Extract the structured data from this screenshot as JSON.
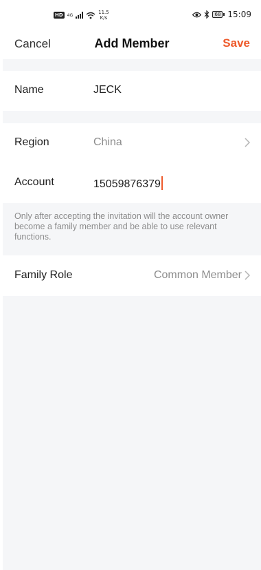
{
  "status_bar": {
    "hd": "HD",
    "network": "4G",
    "speed_value": "11.5",
    "speed_unit": "K/s",
    "battery": "68",
    "time": "15:09"
  },
  "nav": {
    "cancel": "Cancel",
    "title": "Add Member",
    "save": "Save",
    "accent_color": "#ee5a2b"
  },
  "form": {
    "name": {
      "label": "Name",
      "value": "JECK"
    },
    "region": {
      "label": "Region",
      "value": "China"
    },
    "account": {
      "label": "Account",
      "value": "15059876379"
    },
    "notice": "Only after accepting the invitation will the account owner become a family member and be able to use relevant functions.",
    "family_role": {
      "label": "Family Role",
      "value": "Common Member"
    }
  },
  "icons": [
    "eye-icon",
    "bluetooth-icon",
    "battery-icon",
    "wifi-icon",
    "signal-icon",
    "chevron-right-icon"
  ]
}
